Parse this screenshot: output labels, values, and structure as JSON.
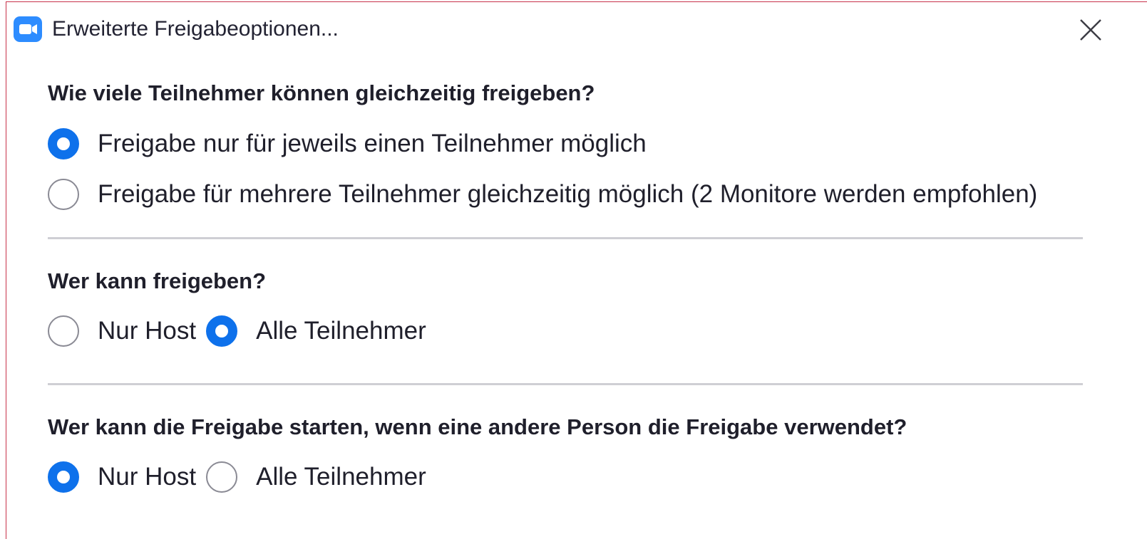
{
  "window": {
    "title": "Erweiterte Freigabeoptionen...",
    "app_icon": "video-camera-icon",
    "close_icon": "close-icon",
    "accent_color": "#0e71eb",
    "icon_color": "#2d8cff"
  },
  "sections": [
    {
      "heading": "Wie viele Teilnehmer können gleichzeitig freigeben?",
      "options": [
        {
          "label": "Freigabe nur für jeweils einen Teilnehmer möglich",
          "selected": true
        },
        {
          "label": "Freigabe für mehrere Teilnehmer gleichzeitig möglich (2 Monitore werden empfohlen)",
          "selected": false
        }
      ]
    },
    {
      "heading": "Wer kann freigeben?",
      "options": [
        {
          "label": "Nur Host",
          "selected": false
        },
        {
          "label": "Alle Teilnehmer",
          "selected": true
        }
      ]
    },
    {
      "heading": "Wer kann die Freigabe starten, wenn eine andere Person die Freigabe verwendet?",
      "options": [
        {
          "label": "Nur Host",
          "selected": true
        },
        {
          "label": "Alle Teilnehmer",
          "selected": false
        }
      ]
    }
  ]
}
